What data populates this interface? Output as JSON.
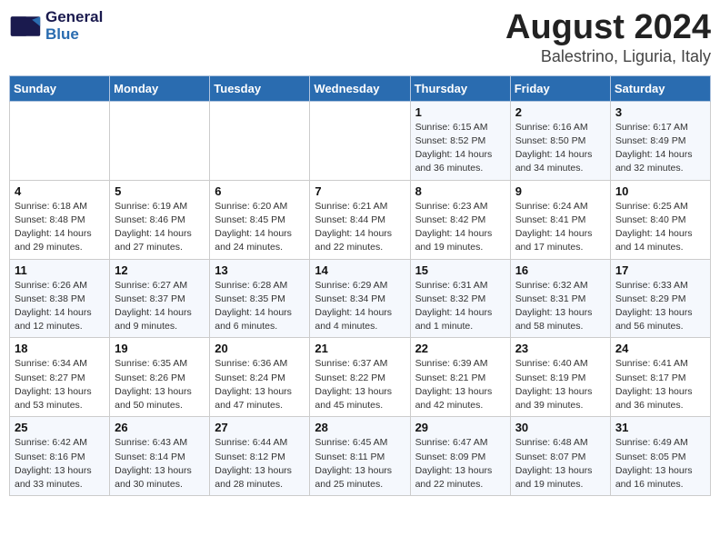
{
  "logo": {
    "line1": "General",
    "line2": "Blue"
  },
  "title": "August 2024",
  "location": "Balestrino, Liguria, Italy",
  "days_of_week": [
    "Sunday",
    "Monday",
    "Tuesday",
    "Wednesday",
    "Thursday",
    "Friday",
    "Saturday"
  ],
  "weeks": [
    [
      {
        "day": "",
        "detail": ""
      },
      {
        "day": "",
        "detail": ""
      },
      {
        "day": "",
        "detail": ""
      },
      {
        "day": "",
        "detail": ""
      },
      {
        "day": "1",
        "detail": "Sunrise: 6:15 AM\nSunset: 8:52 PM\nDaylight: 14 hours\nand 36 minutes."
      },
      {
        "day": "2",
        "detail": "Sunrise: 6:16 AM\nSunset: 8:50 PM\nDaylight: 14 hours\nand 34 minutes."
      },
      {
        "day": "3",
        "detail": "Sunrise: 6:17 AM\nSunset: 8:49 PM\nDaylight: 14 hours\nand 32 minutes."
      }
    ],
    [
      {
        "day": "4",
        "detail": "Sunrise: 6:18 AM\nSunset: 8:48 PM\nDaylight: 14 hours\nand 29 minutes."
      },
      {
        "day": "5",
        "detail": "Sunrise: 6:19 AM\nSunset: 8:46 PM\nDaylight: 14 hours\nand 27 minutes."
      },
      {
        "day": "6",
        "detail": "Sunrise: 6:20 AM\nSunset: 8:45 PM\nDaylight: 14 hours\nand 24 minutes."
      },
      {
        "day": "7",
        "detail": "Sunrise: 6:21 AM\nSunset: 8:44 PM\nDaylight: 14 hours\nand 22 minutes."
      },
      {
        "day": "8",
        "detail": "Sunrise: 6:23 AM\nSunset: 8:42 PM\nDaylight: 14 hours\nand 19 minutes."
      },
      {
        "day": "9",
        "detail": "Sunrise: 6:24 AM\nSunset: 8:41 PM\nDaylight: 14 hours\nand 17 minutes."
      },
      {
        "day": "10",
        "detail": "Sunrise: 6:25 AM\nSunset: 8:40 PM\nDaylight: 14 hours\nand 14 minutes."
      }
    ],
    [
      {
        "day": "11",
        "detail": "Sunrise: 6:26 AM\nSunset: 8:38 PM\nDaylight: 14 hours\nand 12 minutes."
      },
      {
        "day": "12",
        "detail": "Sunrise: 6:27 AM\nSunset: 8:37 PM\nDaylight: 14 hours\nand 9 minutes."
      },
      {
        "day": "13",
        "detail": "Sunrise: 6:28 AM\nSunset: 8:35 PM\nDaylight: 14 hours\nand 6 minutes."
      },
      {
        "day": "14",
        "detail": "Sunrise: 6:29 AM\nSunset: 8:34 PM\nDaylight: 14 hours\nand 4 minutes."
      },
      {
        "day": "15",
        "detail": "Sunrise: 6:31 AM\nSunset: 8:32 PM\nDaylight: 14 hours\nand 1 minute."
      },
      {
        "day": "16",
        "detail": "Sunrise: 6:32 AM\nSunset: 8:31 PM\nDaylight: 13 hours\nand 58 minutes."
      },
      {
        "day": "17",
        "detail": "Sunrise: 6:33 AM\nSunset: 8:29 PM\nDaylight: 13 hours\nand 56 minutes."
      }
    ],
    [
      {
        "day": "18",
        "detail": "Sunrise: 6:34 AM\nSunset: 8:27 PM\nDaylight: 13 hours\nand 53 minutes."
      },
      {
        "day": "19",
        "detail": "Sunrise: 6:35 AM\nSunset: 8:26 PM\nDaylight: 13 hours\nand 50 minutes."
      },
      {
        "day": "20",
        "detail": "Sunrise: 6:36 AM\nSunset: 8:24 PM\nDaylight: 13 hours\nand 47 minutes."
      },
      {
        "day": "21",
        "detail": "Sunrise: 6:37 AM\nSunset: 8:22 PM\nDaylight: 13 hours\nand 45 minutes."
      },
      {
        "day": "22",
        "detail": "Sunrise: 6:39 AM\nSunset: 8:21 PM\nDaylight: 13 hours\nand 42 minutes."
      },
      {
        "day": "23",
        "detail": "Sunrise: 6:40 AM\nSunset: 8:19 PM\nDaylight: 13 hours\nand 39 minutes."
      },
      {
        "day": "24",
        "detail": "Sunrise: 6:41 AM\nSunset: 8:17 PM\nDaylight: 13 hours\nand 36 minutes."
      }
    ],
    [
      {
        "day": "25",
        "detail": "Sunrise: 6:42 AM\nSunset: 8:16 PM\nDaylight: 13 hours\nand 33 minutes."
      },
      {
        "day": "26",
        "detail": "Sunrise: 6:43 AM\nSunset: 8:14 PM\nDaylight: 13 hours\nand 30 minutes."
      },
      {
        "day": "27",
        "detail": "Sunrise: 6:44 AM\nSunset: 8:12 PM\nDaylight: 13 hours\nand 28 minutes."
      },
      {
        "day": "28",
        "detail": "Sunrise: 6:45 AM\nSunset: 8:11 PM\nDaylight: 13 hours\nand 25 minutes."
      },
      {
        "day": "29",
        "detail": "Sunrise: 6:47 AM\nSunset: 8:09 PM\nDaylight: 13 hours\nand 22 minutes."
      },
      {
        "day": "30",
        "detail": "Sunrise: 6:48 AM\nSunset: 8:07 PM\nDaylight: 13 hours\nand 19 minutes."
      },
      {
        "day": "31",
        "detail": "Sunrise: 6:49 AM\nSunset: 8:05 PM\nDaylight: 13 hours\nand 16 minutes."
      }
    ]
  ]
}
